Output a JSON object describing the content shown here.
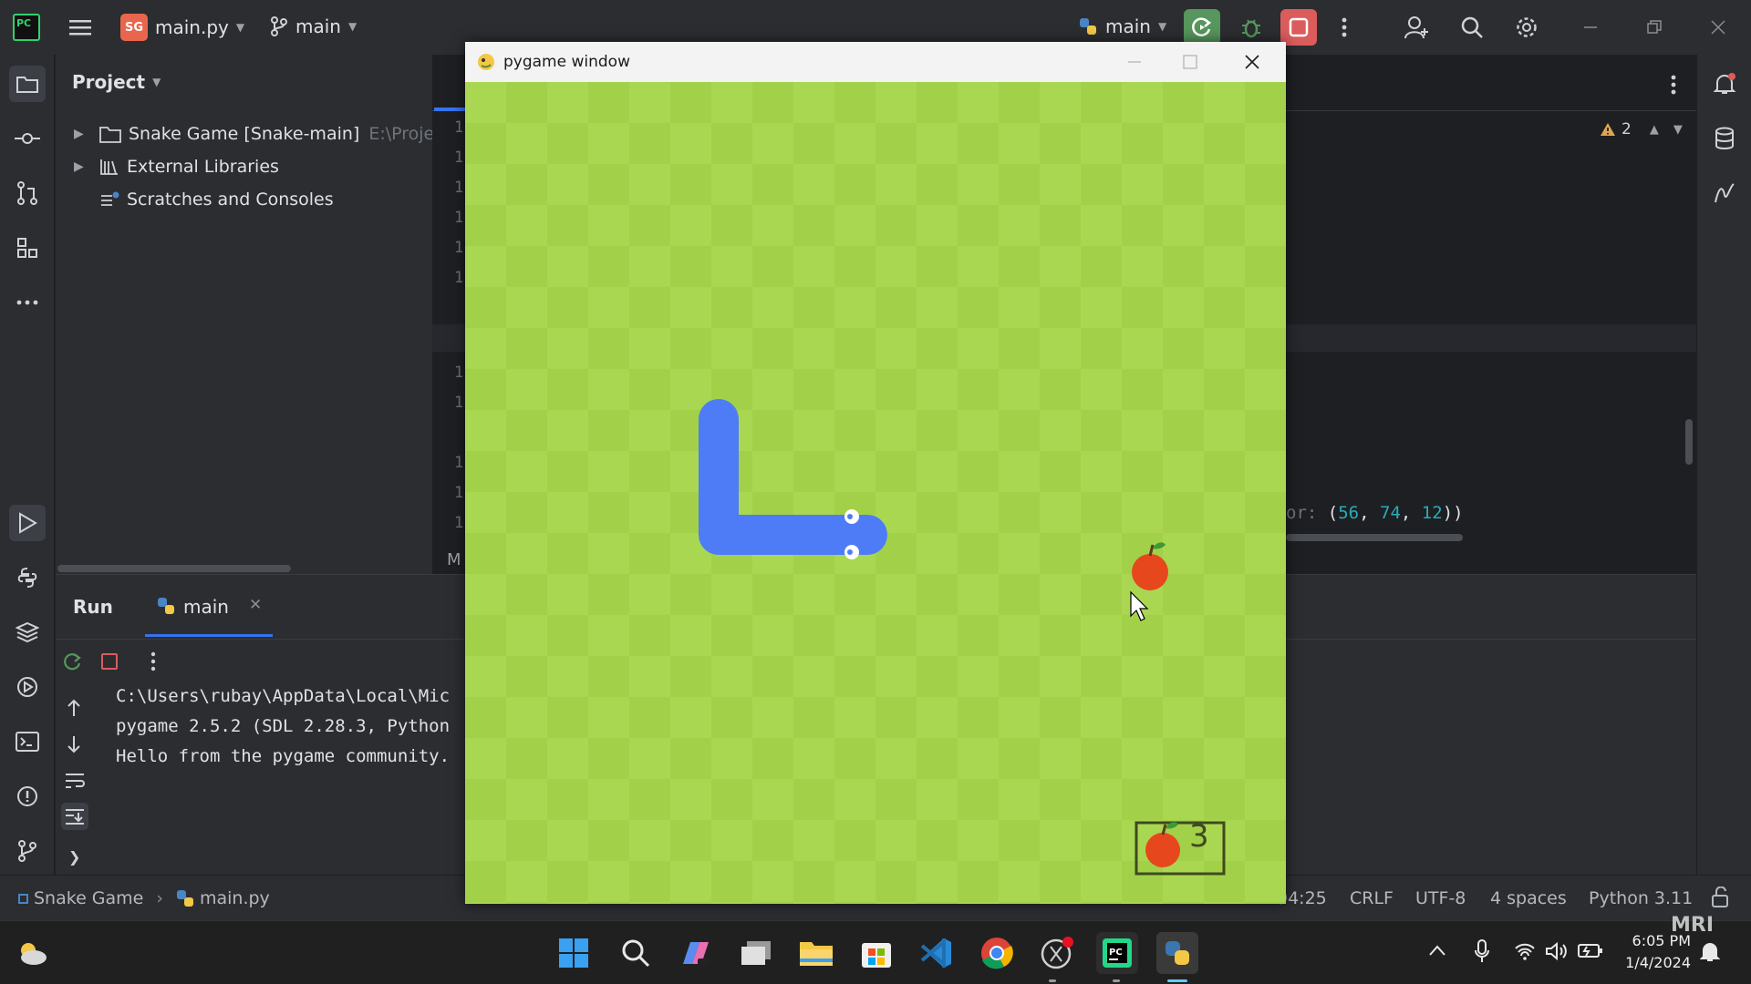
{
  "titlebar": {
    "project_badge": "SG",
    "file_name": "main.py",
    "branch": "main",
    "run_config": "main"
  },
  "project_panel": {
    "title": "Project",
    "items": [
      {
        "label": "Snake Game [Snake-main]",
        "path": "E:\\Proje"
      },
      {
        "label": "External Libraries"
      },
      {
        "label": "Scratches and Consoles"
      }
    ]
  },
  "editor": {
    "warning_count": "2",
    "code_snippet": {
      "prefix": "or:",
      "open": "(",
      "n1": "56",
      "n2": "74",
      "n3": "12",
      "close": "))"
    },
    "line_numbers": [
      "1",
      "1",
      "1",
      "1",
      "1",
      "1",
      "1",
      "1",
      "1",
      "1",
      "1",
      "1"
    ],
    "bottom_fragment": "M"
  },
  "run_panel": {
    "tab_run": "Run",
    "tab_main": "main",
    "console": [
      "C:\\Users\\rubay\\AppData\\Local\\Mic",
      "pygame 2.5.2 (SDL 2.28.3, Python",
      "Hello from the pygame community."
    ]
  },
  "statusbar": {
    "project": "Snake Game",
    "file": "main.py",
    "position": "94:25",
    "line_ending": "CRLF",
    "encoding": "UTF-8",
    "indent": "4 spaces",
    "interpreter": "Python 3.11"
  },
  "pygame": {
    "title": "pygame window",
    "score": "3"
  },
  "taskbar": {
    "time": "6:05 PM",
    "date": "1/4/2024",
    "watermark": "MRI"
  },
  "colors": {
    "accent_green": "#57965c",
    "stop_red": "#db5c5c",
    "snake_blue": "#4e7cf6",
    "apple_red": "#e7471d",
    "grass_light": "#aad751",
    "grass_dark": "#a2d149"
  }
}
